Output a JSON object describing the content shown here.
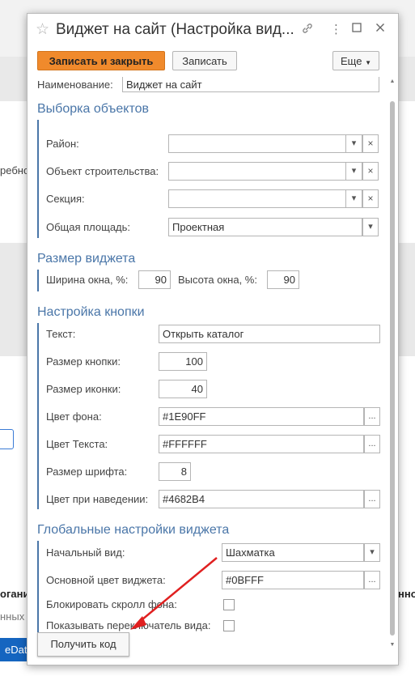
{
  "background": {
    "frag_1": "ребно",
    "frag_2": "огани",
    "frag_3": "нных",
    "frag_4": "нно",
    "frag_5": "eData"
  },
  "window": {
    "title": "Виджет на сайт (Настройка вид...",
    "icons": [
      "star-icon",
      "link-icon",
      "more-vertical-icon",
      "maximize-icon",
      "close-icon"
    ]
  },
  "toolbar": {
    "save_close": "Записать и закрыть",
    "save": "Записать",
    "more": "Еще"
  },
  "form": {
    "name_label": "Наименование:",
    "name_value": "Виджет на сайт",
    "selection": {
      "title": "Выборка объектов",
      "district_label": "Район:",
      "district_value": "",
      "object_label": "Объект строительства:",
      "object_value": "",
      "section_label": "Секция:",
      "section_value": "",
      "area_label": "Общая площадь:",
      "area_value": "Проектная"
    },
    "size": {
      "title": "Размер виджета",
      "width_label": "Ширина окна, %:",
      "width_value": "90",
      "height_label": "Высота окна, %:",
      "height_value": "90"
    },
    "button": {
      "title": "Настройка кнопки",
      "text_label": "Текст:",
      "text_value": "Открыть каталог",
      "btn_size_label": "Размер кнопки:",
      "btn_size_value": "100",
      "icon_size_label": "Размер иконки:",
      "icon_size_value": "40",
      "bg_label": "Цвет фона:",
      "bg_value": "#1E90FF",
      "text_color_label": "Цвет Текста:",
      "text_color_value": "#FFFFFF",
      "font_size_label": "Размер шрифта:",
      "font_size_value": "8",
      "hover_label": "Цвет при наведении:",
      "hover_value": "#4682B4"
    },
    "global": {
      "title": "Глобальные настройки виджета",
      "view_label": "Начальный вид:",
      "view_value": "Шахматка",
      "main_color_label": "Основной цвет виджета:",
      "main_color_value": "#0BFFF",
      "block_scroll_label": "Блокировать скролл фона:",
      "block_scroll_checked": false,
      "show_switch_label": "Показывать переключатель вида:",
      "show_switch_checked": false
    }
  },
  "footer": {
    "get_code": "Получить код"
  },
  "colors": {
    "accent": "#f08a2c",
    "group_title": "#4a76a8",
    "annotation_arrow": "#e02020"
  }
}
